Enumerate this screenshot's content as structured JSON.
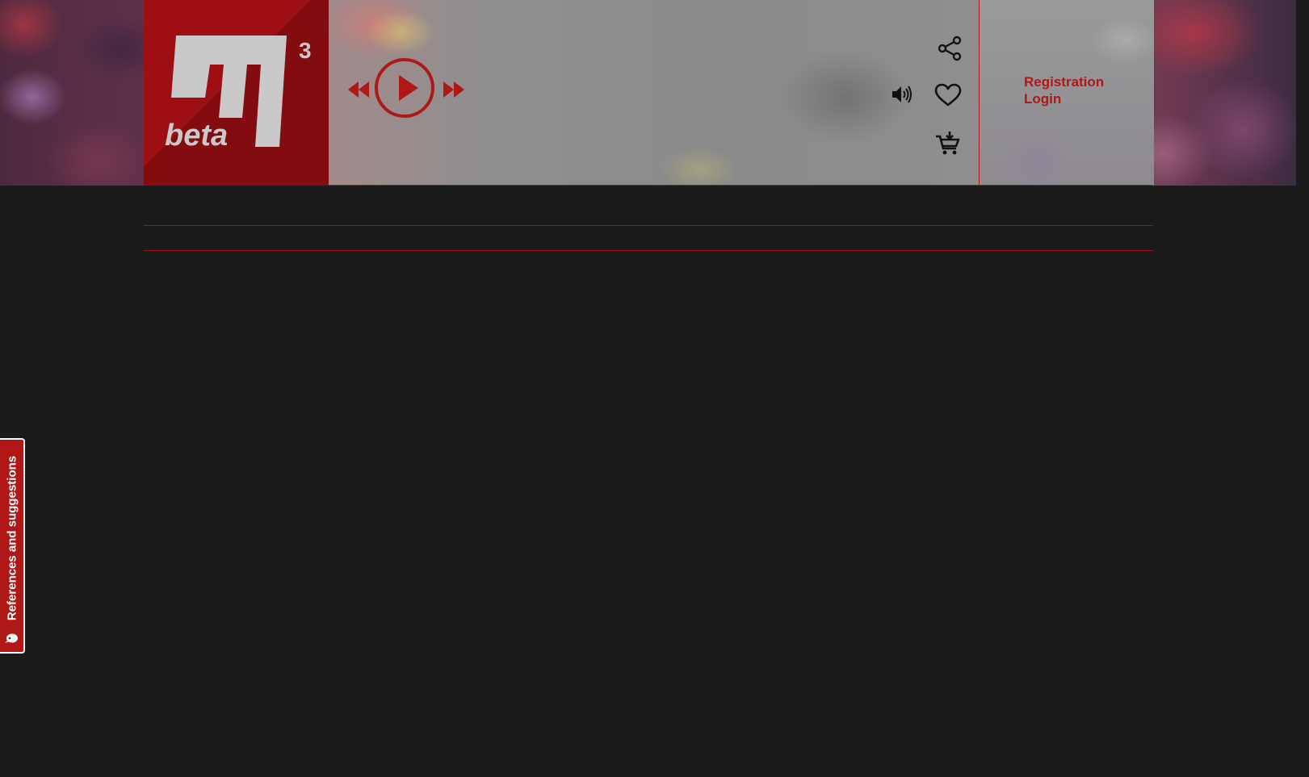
{
  "app": {
    "name": "M3 beta",
    "logo_text": "beta",
    "logo_superscript": "3"
  },
  "player": {
    "rewind_icon": "rewind-icon",
    "play_icon": "play-icon",
    "fast_forward_icon": "fast-forward-icon"
  },
  "actions": {
    "share_icon": "share-icon",
    "volume_icon": "volume-icon",
    "favorite_icon": "heart-icon",
    "cart_icon": "add-to-cart-icon"
  },
  "auth": {
    "registration": "Registration",
    "login": "Login"
  },
  "feedback_tab": {
    "label": "References and suggestions",
    "icon": "chat-bubble-icon"
  },
  "colors": {
    "accent": "#b01818",
    "logo_bg": "#9e0f14",
    "page_bg": "#1b1b1b"
  }
}
